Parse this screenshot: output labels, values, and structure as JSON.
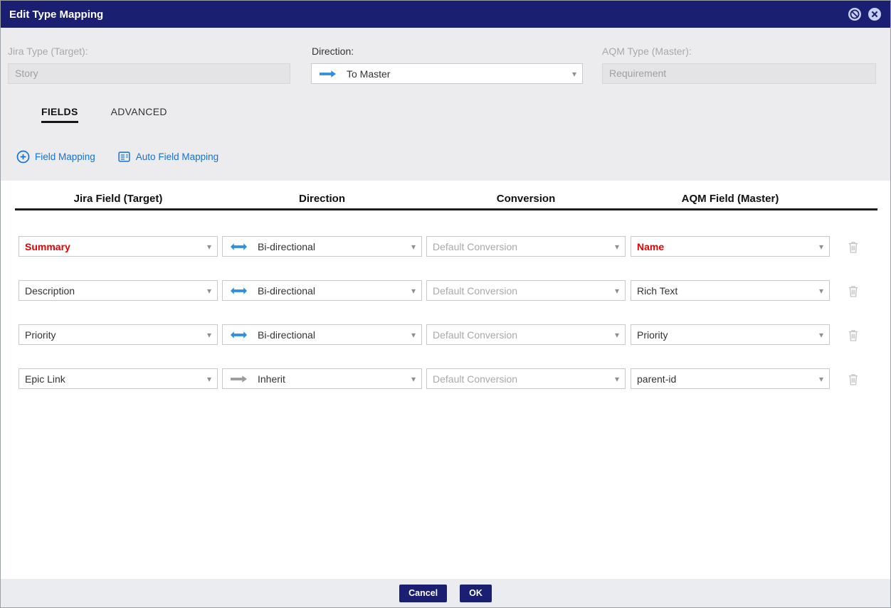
{
  "dialog": {
    "title": "Edit Type Mapping"
  },
  "form": {
    "jira_type": {
      "label": "Jira Type (Target):",
      "value": "Story"
    },
    "direction": {
      "label": "Direction:",
      "value": "To Master"
    },
    "aqm_type": {
      "label": "AQM Type (Master):",
      "value": "Requirement"
    }
  },
  "tabs": [
    {
      "label": "FIELDS",
      "active": true
    },
    {
      "label": "ADVANCED",
      "active": false
    }
  ],
  "actions": {
    "field_mapping": "Field Mapping",
    "auto_field_mapping": "Auto Field Mapping"
  },
  "table": {
    "headers": [
      "Jira Field (Target)",
      "Direction",
      "Conversion",
      "AQM Field (Master)"
    ],
    "rows": [
      {
        "jira_field": "Summary",
        "direction": "Bi-directional",
        "direction_type": "bi",
        "conversion": "Default Conversion",
        "aqm_field": "Name",
        "highlight": true
      },
      {
        "jira_field": "Description",
        "direction": "Bi-directional",
        "direction_type": "bi",
        "conversion": "Default Conversion",
        "aqm_field": "Rich Text",
        "highlight": false
      },
      {
        "jira_field": "Priority",
        "direction": "Bi-directional",
        "direction_type": "bi",
        "conversion": "Default Conversion",
        "aqm_field": "Priority",
        "highlight": false
      },
      {
        "jira_field": "Epic Link",
        "direction": "Inherit",
        "direction_type": "inherit",
        "conversion": "Default Conversion",
        "aqm_field": "parent-id",
        "highlight": false
      }
    ]
  },
  "footer": {
    "cancel": "Cancel",
    "ok": "OK"
  },
  "icons": {
    "chevron": "▾"
  },
  "colors": {
    "titlebar": "#1b1f72",
    "link_blue": "#1572cf",
    "arrow_blue": "#2e8ee2",
    "arrow_gray": "#9b9b9b",
    "highlight_red": "#e60000",
    "button": "#1b1f72"
  }
}
